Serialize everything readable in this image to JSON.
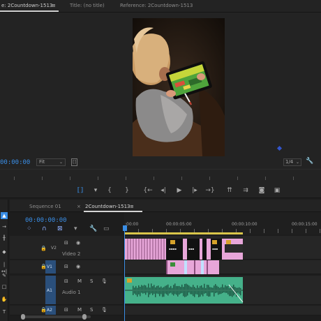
{
  "monitor": {
    "tabs": [
      {
        "label": "e: 2Countdown-1513",
        "active": true
      },
      {
        "label": "Title: (no title)",
        "active": false
      },
      {
        "label": "Reference: 2Countdown-1513",
        "active": false
      }
    ],
    "menu_glyph": "≡",
    "timecode": "00:00:00",
    "fit_label": "Fit",
    "quality_label": "1/4"
  },
  "transport": {
    "buttons": [
      "insert-bracket",
      "add-marker",
      "mark-in",
      "mark-out",
      "go-to-in",
      "step-back",
      "play",
      "step-forward",
      "go-to-out",
      "lift",
      "extract",
      "export-frame",
      "compare"
    ]
  },
  "timeline": {
    "tabs": [
      {
        "label": "Sequence 01",
        "active": false
      },
      {
        "label": "2Countdown-1513",
        "active": true
      }
    ],
    "close_glyph": "×",
    "menu_glyph": "≡",
    "timecode": "00:00:00:00",
    "ruler_labels": [
      ":00:00",
      "00:00:05:00",
      "00:00:10:00",
      "00:00:15:00"
    ],
    "tracks": {
      "v2": {
        "lock": "🔒",
        "name": "V2",
        "label": "Video 2"
      },
      "v1": {
        "name": "V1"
      },
      "a1": {
        "source": "A1",
        "name": "A1",
        "label": "Audio 1",
        "mute": "M",
        "solo": "S"
      },
      "a2": {
        "source": "A2",
        "name": "A2",
        "mute": "M",
        "solo": "S"
      }
    },
    "colors": {
      "video_clip": "#e7a6d9",
      "audio_clip": "#45b18a",
      "title_clip_bg": "#111111",
      "accent": "#3a8ee6"
    }
  }
}
